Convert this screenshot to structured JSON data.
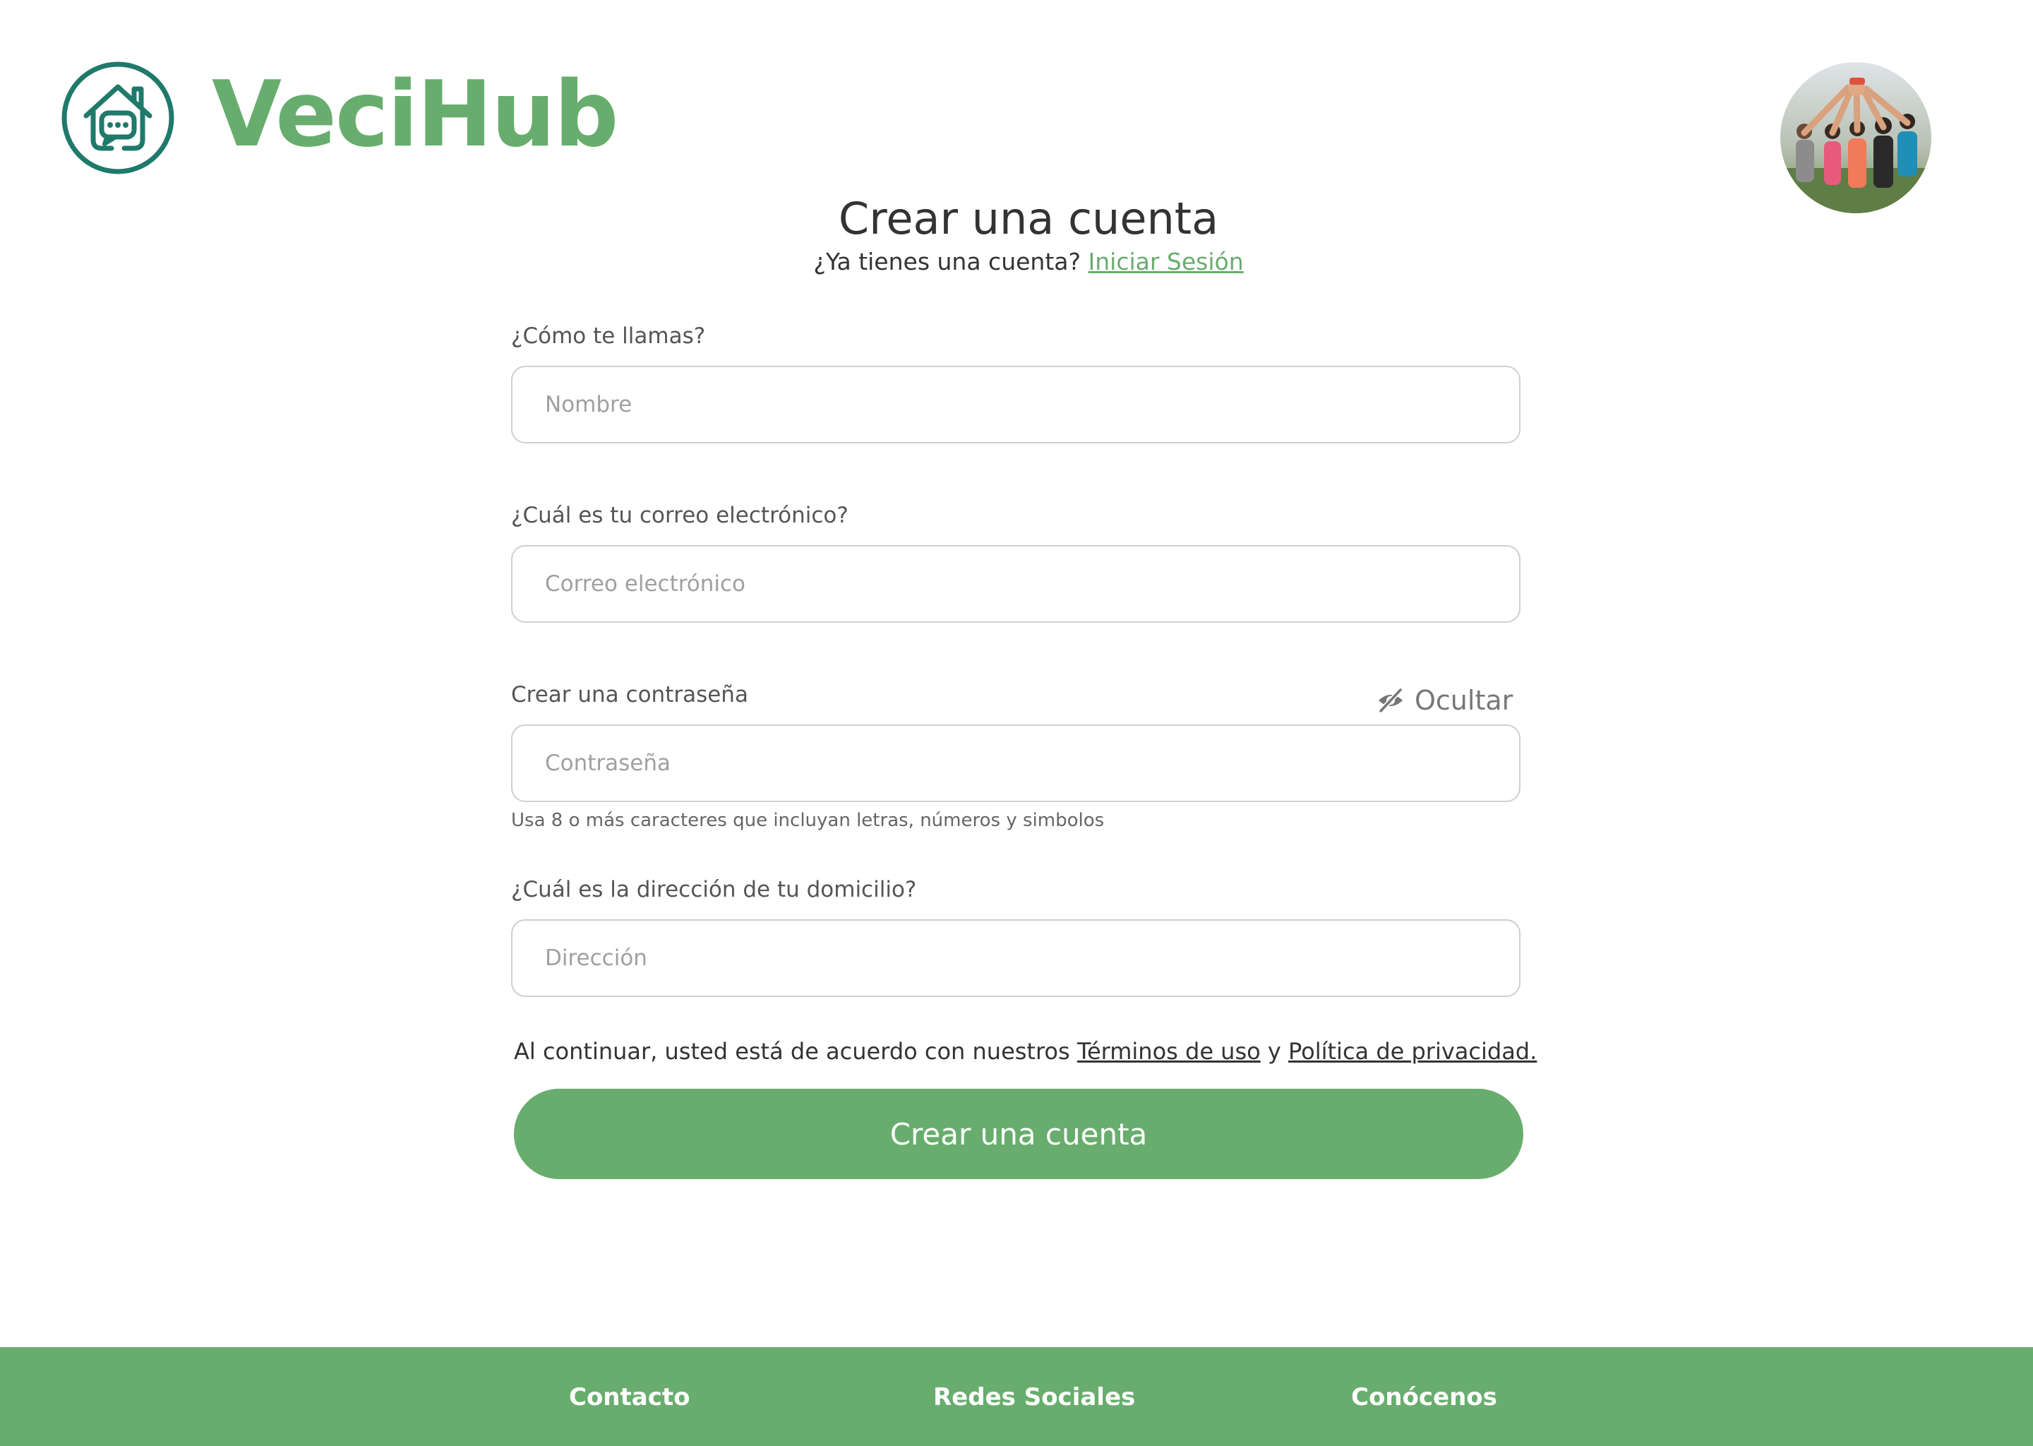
{
  "brand": {
    "name": "VeciHub",
    "color": "#68ad6d",
    "logo_icon": "house-chat-icon",
    "logo_color": "#1f7a6b"
  },
  "header": {
    "avatar_icon": "user-avatar-photo"
  },
  "page": {
    "title": "Crear una cuenta",
    "subtitle_prefix": "¿Ya tienes una cuenta?",
    "login_link": "Iniciar Sesión"
  },
  "form": {
    "name": {
      "label": "¿Cómo te llamas?",
      "placeholder": "Nombre",
      "value": ""
    },
    "email": {
      "label": "¿Cuál es tu correo electrónico?",
      "placeholder": "Correo electrónico",
      "value": ""
    },
    "password": {
      "label": "Crear una contraseña",
      "placeholder": "Contraseña",
      "value": "",
      "toggle_label": "Ocultar",
      "toggle_icon": "eye-slash-icon",
      "hint": "Usa 8 o más caracteres que incluyan letras, números y simbolos"
    },
    "address": {
      "label": "¿Cuál es la dirección de tu domicilio?",
      "placeholder": "Dirección",
      "value": ""
    },
    "terms": {
      "prefix": "Al continuar, usted está de acuerdo con nuestros",
      "terms_link": "Términos de uso",
      "conjunction": "y",
      "privacy_link": "Política de privacidad."
    },
    "submit_label": "Crear una cuenta"
  },
  "footer": {
    "background": "#68ad6d",
    "links": [
      "Contacto",
      "Redes Sociales",
      "Conócenos"
    ]
  }
}
